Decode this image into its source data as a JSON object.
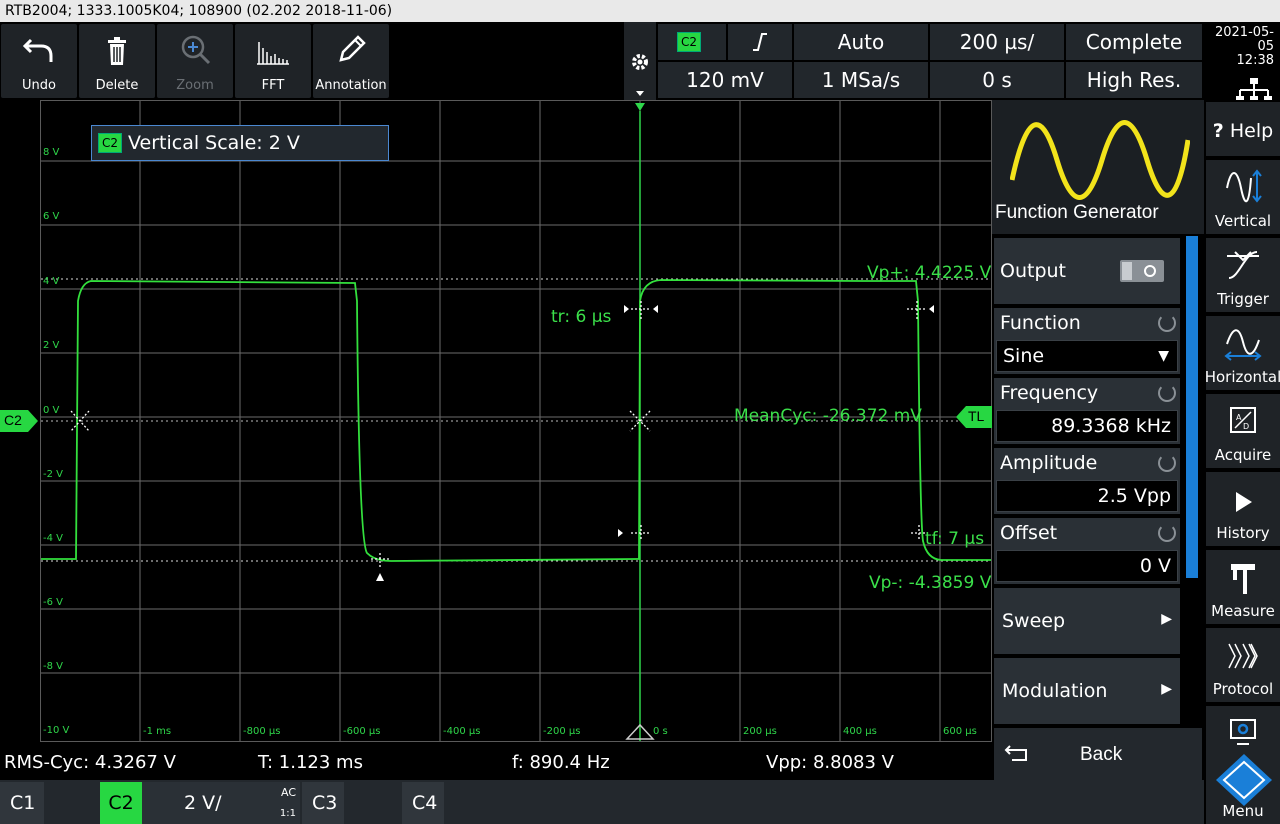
{
  "title_bar": "RTB2004; 1333.1005K04; 108900 (02.202 2018-11-06)",
  "toolbar": {
    "undo": "Undo",
    "delete": "Delete",
    "zoom": "Zoom",
    "fft": "FFT",
    "annotation": "Annotation"
  },
  "top_info": {
    "channel": "C2",
    "trigger_slope": "rising",
    "trigger_mode": "Auto",
    "time_scale": "200 µs/",
    "acq_state": "Complete",
    "trigger_level": "120 mV",
    "sample_rate": "1 MSa/s",
    "time_offset": "0 s",
    "acq_mode": "High Res.",
    "date": "2021-05-05",
    "time": "12:38"
  },
  "screen": {
    "vertical_scale_box": "Vertical Scale: 2 V",
    "y_labels": [
      "8 V",
      "6 V",
      "4 V",
      "2 V",
      "0 V",
      "-2 V",
      "-4 V",
      "-6 V",
      "-8 V",
      "-10 V"
    ],
    "x_labels": [
      "-1 ms",
      "-800 µs",
      "-600 µs",
      "-400 µs",
      "-200 µs",
      "0 s",
      "200 µs",
      "400 µs",
      "600 µs"
    ],
    "channel_marker": "C2",
    "trigger_marker": "TL",
    "measurements": {
      "vp_plus": "Vp+: 4.4225 V",
      "tr": "tr: 6 µs",
      "mean_cyc": "MeanCyc: -26.372 mV",
      "tf": "tf: 7 µs",
      "vp_minus": "Vp-: -4.3859 V"
    }
  },
  "function_generator": {
    "title": "Function Generator",
    "output_label": "Output",
    "function_label": "Function",
    "function_value": "Sine",
    "frequency_label": "Frequency",
    "frequency_value": "89.3368 kHz",
    "amplitude_label": "Amplitude",
    "amplitude_value": "2.5 Vpp",
    "offset_label": "Offset",
    "offset_value": "0 V",
    "sweep_label": "Sweep",
    "modulation_label": "Modulation",
    "back_label": "Back"
  },
  "nav": {
    "help": "Help",
    "vertical": "Vertical",
    "trigger": "Trigger",
    "horizontal": "Horizontal",
    "acquire": "Acquire",
    "history": "History",
    "measure": "Measure",
    "protocol": "Protocol",
    "menu": "Menu"
  },
  "bottom_measurements": {
    "rms": "RMS-Cyc: 4.3267 V",
    "period": "T: 1.123 ms",
    "freq": "f: 890.4 Hz",
    "vpp": "Vpp: 8.8083 V"
  },
  "channels": {
    "c1": "C1",
    "c2": "C2",
    "c2_scale": "2 V/",
    "c2_coupling": "AC",
    "c2_probe": "1:1",
    "c3": "C3",
    "c4": "C4"
  },
  "colors": {
    "trace": "#33e03d",
    "accent_blue": "#1a7fd8",
    "panel": "#22272c"
  }
}
